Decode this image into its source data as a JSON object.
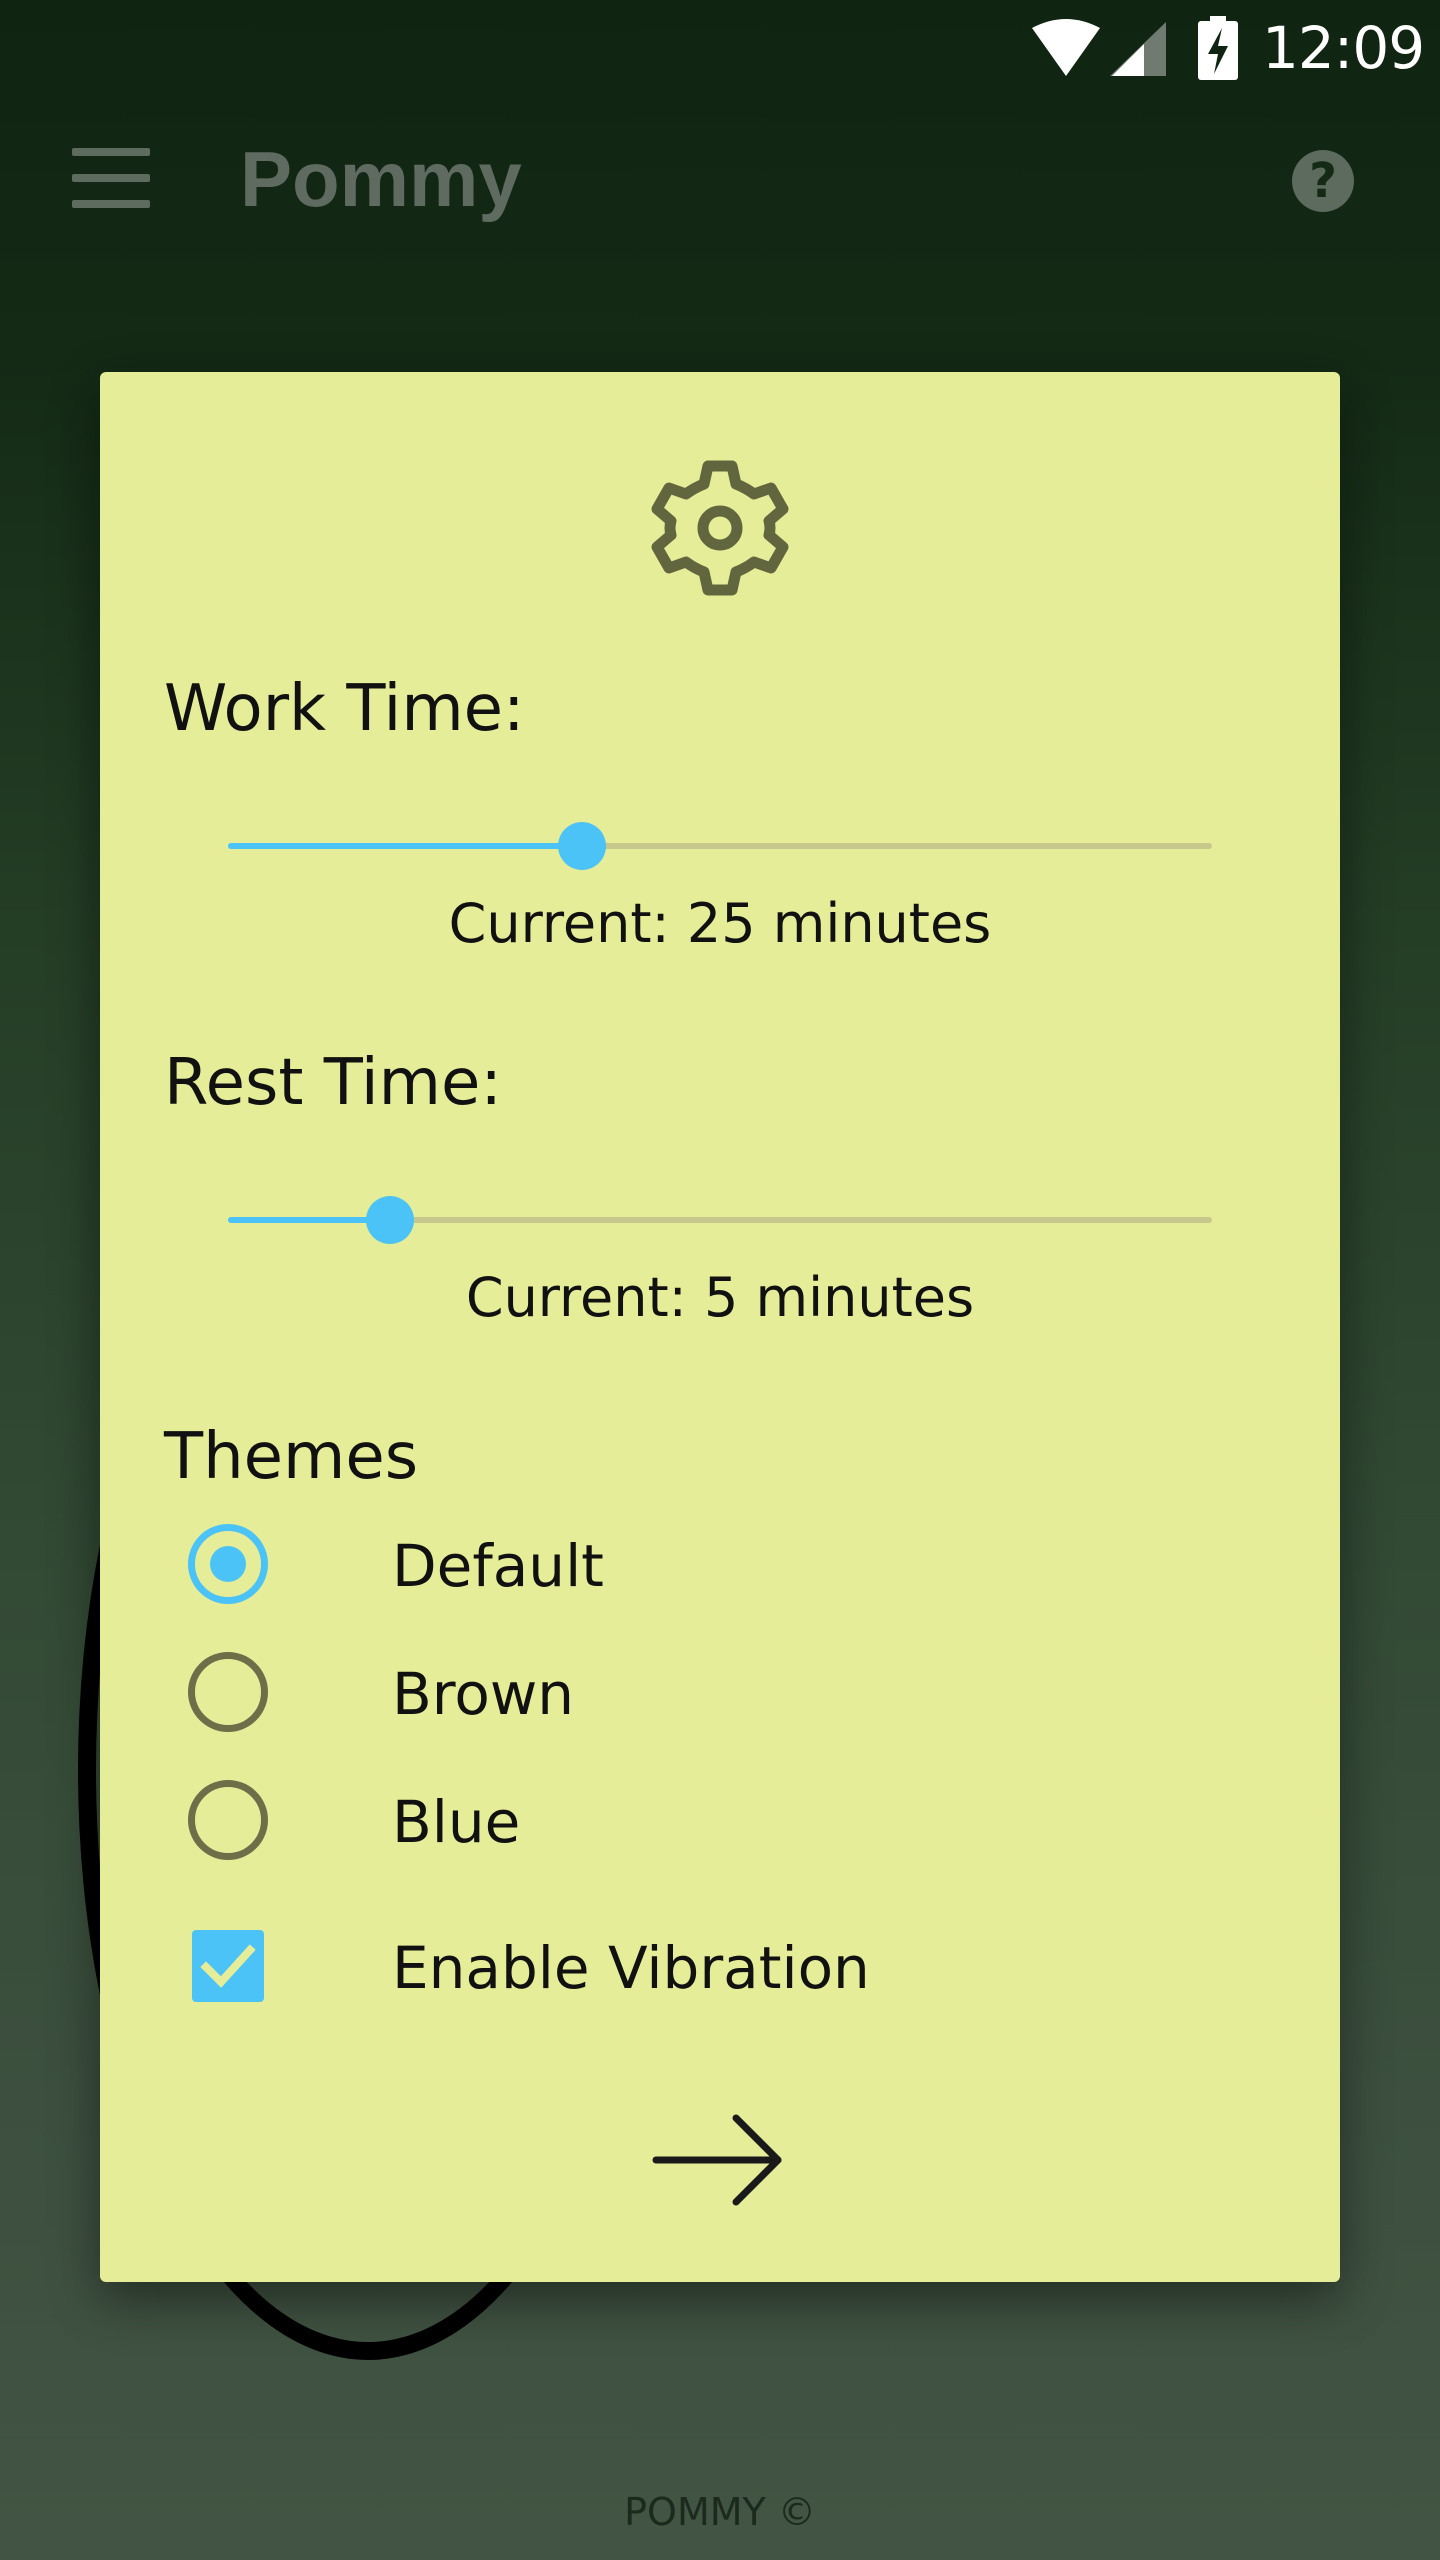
{
  "status_bar": {
    "time": "12:09",
    "icons": [
      "wifi-icon",
      "signal-icon",
      "battery-charging-icon"
    ]
  },
  "toolbar": {
    "menu_icon": "menu-icon",
    "title": "Pommy",
    "help_icon": "help-icon"
  },
  "dialog": {
    "header_icon": "settings-icon",
    "work_time": {
      "label": "Work Time:",
      "slider_fraction": 0.36,
      "current": "Current: 25 minutes"
    },
    "rest_time": {
      "label": "Rest Time:",
      "slider_fraction": 0.165,
      "current": "Current: 5 minutes"
    },
    "themes": {
      "label": "Themes",
      "options": [
        {
          "label": "Default",
          "selected": true
        },
        {
          "label": "Brown",
          "selected": false
        },
        {
          "label": "Blue",
          "selected": false
        }
      ]
    },
    "vibration": {
      "label": "Enable Vibration",
      "checked": true
    },
    "next_icon": "arrow-right-icon"
  },
  "footer": {
    "text": "POMMY ©"
  },
  "colors": {
    "accent": "#4cc3f6",
    "dialog_background": "#e6ed98",
    "app_background": "#142a15"
  }
}
